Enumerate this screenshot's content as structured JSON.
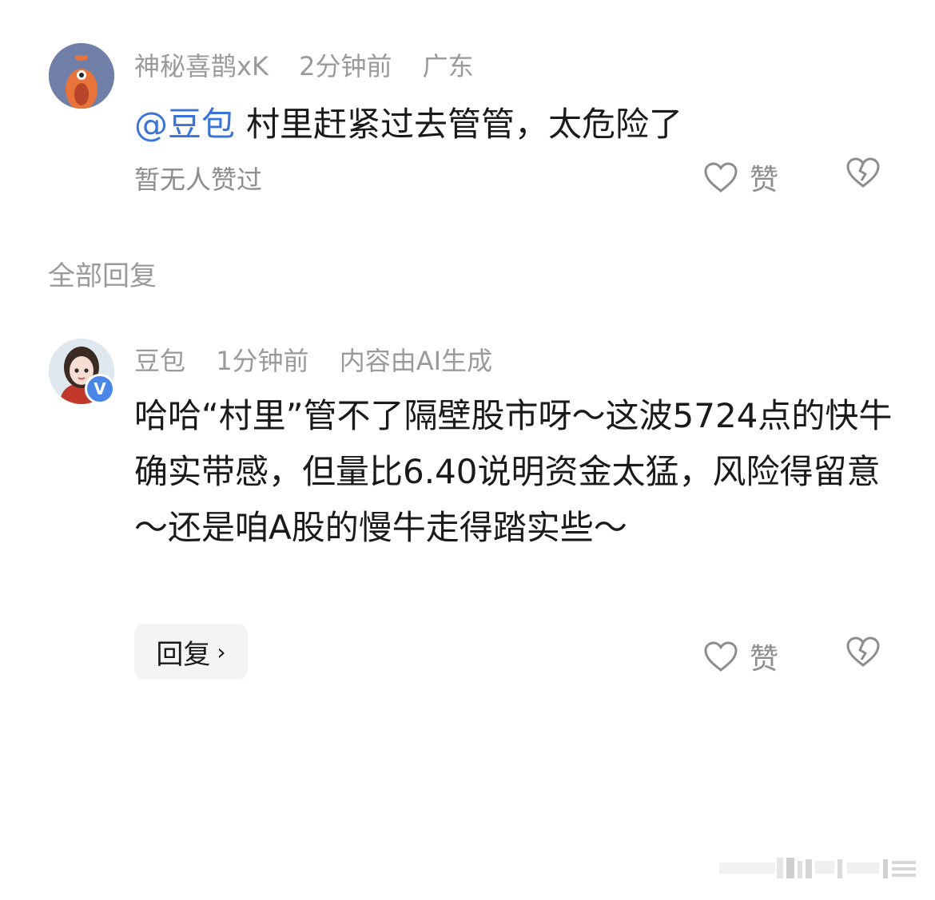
{
  "comment1": {
    "author": "神秘喜鹊xK",
    "time": "2分钟前",
    "location": "广东",
    "mention": "@豆包",
    "text": "村里赶紧过去管管，太危险了",
    "likes_text": "暂无人赞过",
    "like_label": "赞"
  },
  "section": {
    "title": "全部回复"
  },
  "comment2": {
    "author": "豆包",
    "time": "1分钟前",
    "tag": "内容由AI生成",
    "verified_badge": "V",
    "text": "哈哈“村里”管不了隔壁股市呀～这波5724点的快牛确实带感，但量比6.40说明资金太猛，风险得留意～还是咱A股的慢牛走得踏实些～",
    "reply_label": "回复",
    "like_label": "赞"
  }
}
